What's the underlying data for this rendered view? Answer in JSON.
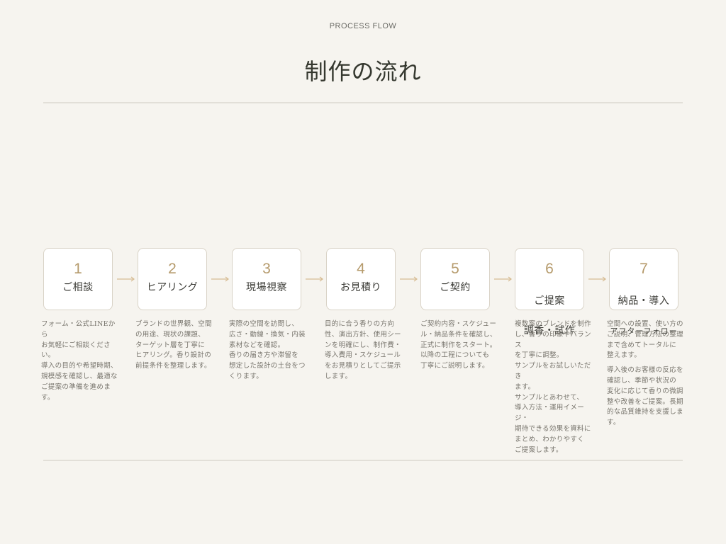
{
  "header": {
    "eyebrow": "PROCESS FLOW",
    "title": "制作の流れ"
  },
  "colors": {
    "background": "#f6f4ef",
    "accent": "#b59a6b",
    "card_border": "#d9d3c7",
    "rule": "#e2dfd8",
    "arrow": "#d7bc93"
  },
  "steps": [
    {
      "number": "1",
      "label": "ご相談",
      "description": [
        "フォーム・公式LINEから\nお気軽にご相談ください。\n導入の目的や希望時期、\n規模感を確認し、最適な\nご提案の準備を進めます。"
      ]
    },
    {
      "number": "2",
      "label": "ヒアリング",
      "description": [
        "ブランドの世界観、空間\nの用途、現状の課題、\nターゲット層を丁寧に\nヒアリング。香り設計の\n前提条件を整理します。"
      ]
    },
    {
      "number": "3",
      "label": "現場視察",
      "description": [
        "実際の空間を訪問し、\n広さ・動線・換気・内装\n素材などを確認。\n香りの届き方や滞留を\n想定した設計の土台をつ\nくります。"
      ]
    },
    {
      "number": "4",
      "label": "お見積り",
      "description": [
        "目的に合う香りの方向\n性、演出方針、使用シー\nンを明確にし、制作費・\n導入費用・スケジュール\nをお見積りとしてご提示\nします。"
      ]
    },
    {
      "number": "5",
      "label": "ご契約",
      "description": [
        "ご契約内容・スケジュー\nル・納品条件を確認し、\n正式に制作をスタート。\n以降の工程についても\n丁寧にご説明します。"
      ]
    },
    {
      "number": "6",
      "label_line1": "ご提案",
      "label_line2": "調香・試作",
      "description": [
        "複数案のブレンドを制作\nし、香りの印象やバランス\nを丁寧に調整。\nサンプルをお試しいただき\nます。\nサンプルとあわせて、\n導入方法・運用イメージ・\n期待できる効果を資料に\nまとめ、わかりやすく\nご提案します。"
      ]
    },
    {
      "number": "7",
      "label_line1": "納品・導入",
      "label_line2": "アフターフォロー",
      "description": [
        "空間への設置、使い方の\nご説明、管理方法の整理\nまで含めてトータルに\n整えます。",
        "導入後のお客様の反応を\n確認し、季節や状況の\n変化に応じて香りの微調\n整や改善をご提案。長期\n的な品質維持を支援しま\nす。"
      ]
    }
  ]
}
